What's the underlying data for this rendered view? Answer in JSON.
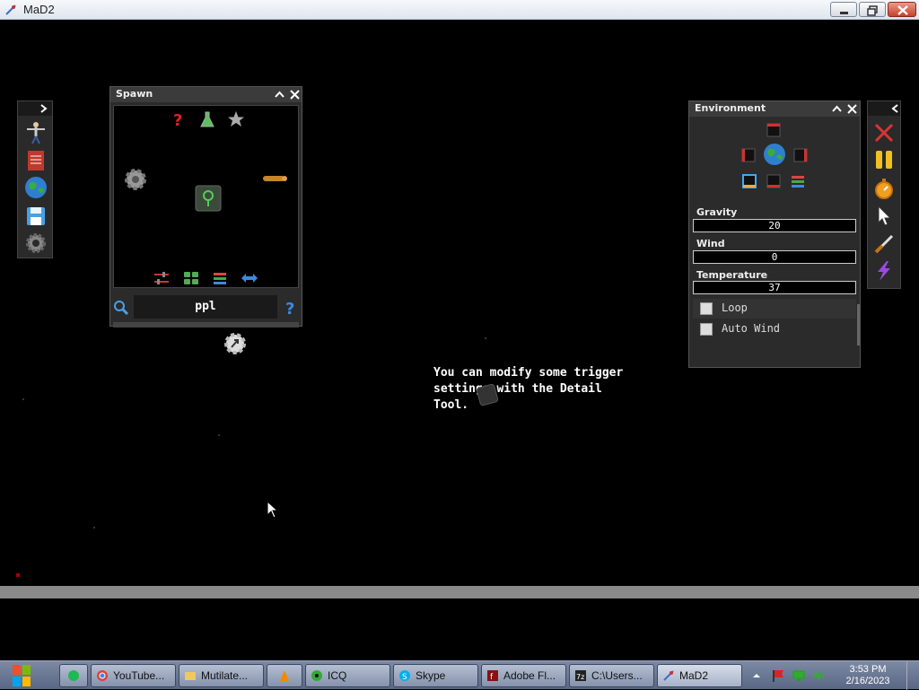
{
  "window": {
    "title": "MaD2"
  },
  "spawn": {
    "title": "Spawn",
    "search_value": "ppl",
    "icons": [
      "question-icon",
      "flask-icon",
      "star-icon",
      "gear-icon",
      "tree-icon",
      "log-icon",
      "sliders-icon",
      "grid-icon",
      "layers-icon",
      "swap-icon",
      "search-icon",
      "help-icon"
    ]
  },
  "environment": {
    "title": "Environment",
    "fields": [
      {
        "label": "Gravity",
        "value": "20"
      },
      {
        "label": "Wind",
        "value": "0"
      },
      {
        "label": "Temperature",
        "value": "37"
      }
    ],
    "checks": [
      {
        "label": "Loop",
        "checked": false
      },
      {
        "label": "Auto Wind",
        "checked": false
      }
    ]
  },
  "tip": "You can modify some trigger\nsettings with the Detail\nTool.",
  "left_toolbar": [
    "person-icon",
    "book-icon",
    "globe-icon",
    "save-icon",
    "gear-icon"
  ],
  "right_toolbar": [
    "close-x-icon",
    "pause-icon",
    "stopwatch-icon",
    "cursor-icon",
    "knife-icon",
    "lightning-icon"
  ],
  "taskbar": {
    "items": [
      {
        "label": "",
        "icon": "spotify-icon"
      },
      {
        "label": "YouTube...",
        "icon": "chrome-icon"
      },
      {
        "label": "Mutilate...",
        "icon": "folder-icon"
      },
      {
        "label": "",
        "icon": "vlc-icon"
      },
      {
        "label": "ICQ",
        "icon": "icq-icon"
      },
      {
        "label": "Skype",
        "icon": "skype-icon"
      },
      {
        "label": "Adobe Fl...",
        "icon": "flash-icon"
      },
      {
        "label": "C:\\Users...",
        "icon": "7zip-icon"
      },
      {
        "label": "MaD2",
        "icon": "mad2-icon"
      }
    ],
    "time": "3:53 PM",
    "date": "2/16/2023"
  }
}
